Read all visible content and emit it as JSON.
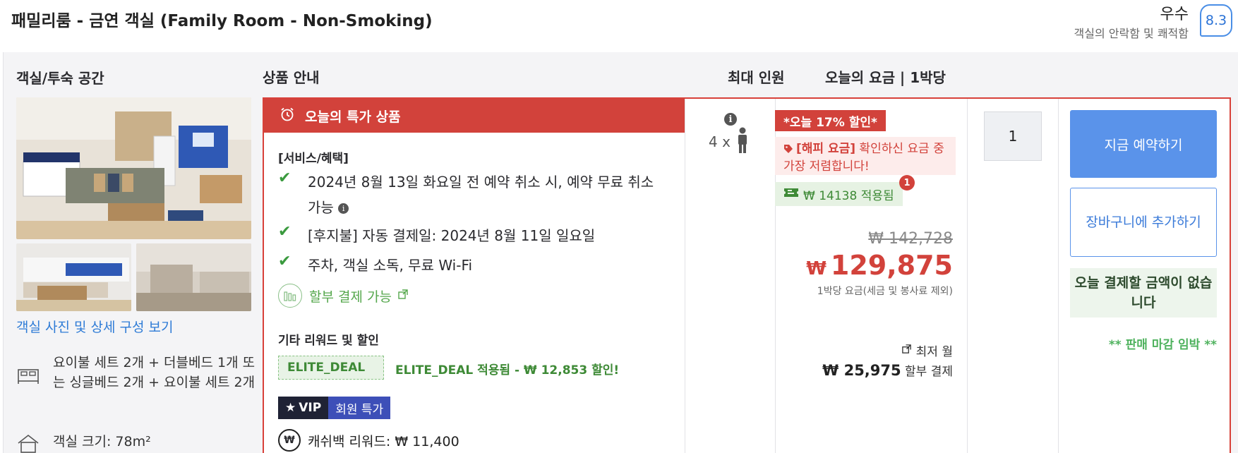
{
  "header": {
    "room_title": "패밀리룸 - 금연 객실 (Family Room - Non-Smoking)",
    "rating_word": "우수",
    "rating_sub": "객실의 안락함 및 쾌적함",
    "score": "8.3"
  },
  "columns": {
    "room_space": "객실/투숙 공간",
    "product_info": "상품 안내",
    "max_guests": "최대 인원",
    "today_rate": "오늘의 요금 | 1박당"
  },
  "room": {
    "photo_link": "객실 사진 및 상세 구성 보기",
    "beds": "요이불 세트 2개 + 더블베드 1개 또는 싱글베드 2개 + 요이불 세트 2개",
    "size": "객실 크기: 78m²"
  },
  "offer": {
    "banner": "오늘의 특가 상품",
    "services_title": "[서비스/혜택]",
    "benefits": [
      "2024년 8월 13일 화요일 전 예약 취소 시, 예약 무료 취소 가능",
      "[후지불] 자동 결제일: 2024년 8월 11일 일요일",
      "주차, 객실 소독, 무료 Wi-Fi"
    ],
    "installment": "할부 결제 가능",
    "rewards_title": "기타 리워드 및 할인",
    "elite_tag": "ELITE_DEAL",
    "elite_desc": "ELITE_DEAL 적용됨 - ₩ 12,853 할인!",
    "vip_label": "VIP",
    "vip_member": "회원 특가",
    "cashback": "캐쉬백 리워드: ₩ 11,400"
  },
  "guests": {
    "text": "4 x"
  },
  "price": {
    "discount_badge": "*오늘 17% 할인*",
    "happy_label": "[해피 요금]",
    "happy_text": " 확인하신 요금 중 가장 저렴합니다!",
    "coupon": "₩ 14138 적용됨",
    "coupon_count": "1",
    "old_price": "₩ 142,728",
    "currency": "₩",
    "new_price": "129,875",
    "per_night": "1박당 요금(세금 및 봉사료 제외)",
    "lowest_label": "최저 월",
    "monthly_amount": "₩ 25,975",
    "monthly_suffix": " 할부 결제"
  },
  "quantity": {
    "value": "1"
  },
  "actions": {
    "book_now": "지금 예약하기",
    "add_to_cart": "장바구니에 추가하기",
    "pay_note": "오늘 결제할 금액이 없습니다",
    "closing_soon": "** 판매 마감 임박 **"
  },
  "colors": {
    "brand_red": "#d2423b",
    "primary_blue": "#5a93ea",
    "success_green": "#3e8a36"
  },
  "icons": [
    "alarm-clock-icon",
    "check-icon",
    "info-icon",
    "person-icon",
    "tag-icon",
    "ticket-icon",
    "external-link-icon",
    "installment-icon",
    "star-icon",
    "cashback-icon",
    "bed-icon",
    "house-icon"
  ]
}
